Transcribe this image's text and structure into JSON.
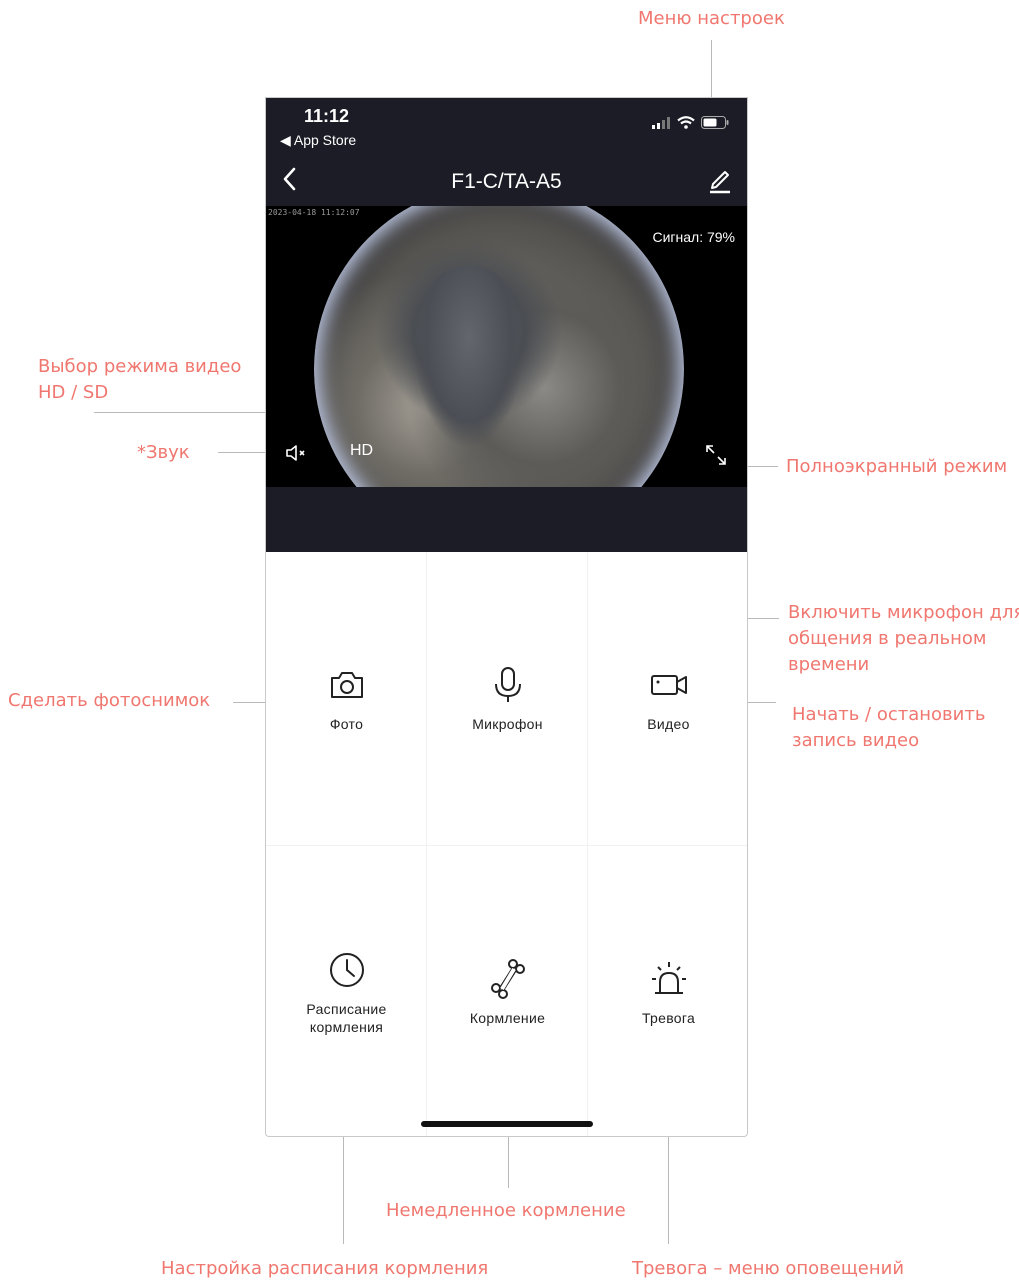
{
  "annotations": {
    "settings_menu": "Меню настроек",
    "video_mode_line1": "Выбор режима видео",
    "video_mode_line2": "HD / SD",
    "sound": "*Звук",
    "fullscreen": "Полноэкранный режим",
    "mic_line1": "Включить микрофон для",
    "mic_line2": "общения в реальном",
    "mic_line3": "времени",
    "photo": "Сделать фотоснимок",
    "video_line1": "Начать / остановить",
    "video_line2": "запись видео",
    "instant_feed": "Немедленное кормление",
    "schedule": "Настройка расписания кормления",
    "alarm": "Тревога – меню оповещений"
  },
  "status_bar": {
    "time": "11:12",
    "back_app": "◀ App Store"
  },
  "nav": {
    "title": "F1-C/TA-A5"
  },
  "video": {
    "timestamp": "2023-04-18 11:12:07",
    "signal": "Сигнал: 79%",
    "quality": "HD"
  },
  "controls": {
    "photo": "Фото",
    "mic": "Микрофон",
    "video": "Видео",
    "schedule_line1": "Расписание",
    "schedule_line2": "кормления",
    "feed": "Кормление",
    "alarm": "Тревога"
  },
  "colors": {
    "annotation": "#f0776f",
    "header_bg": "#1b1c25"
  }
}
